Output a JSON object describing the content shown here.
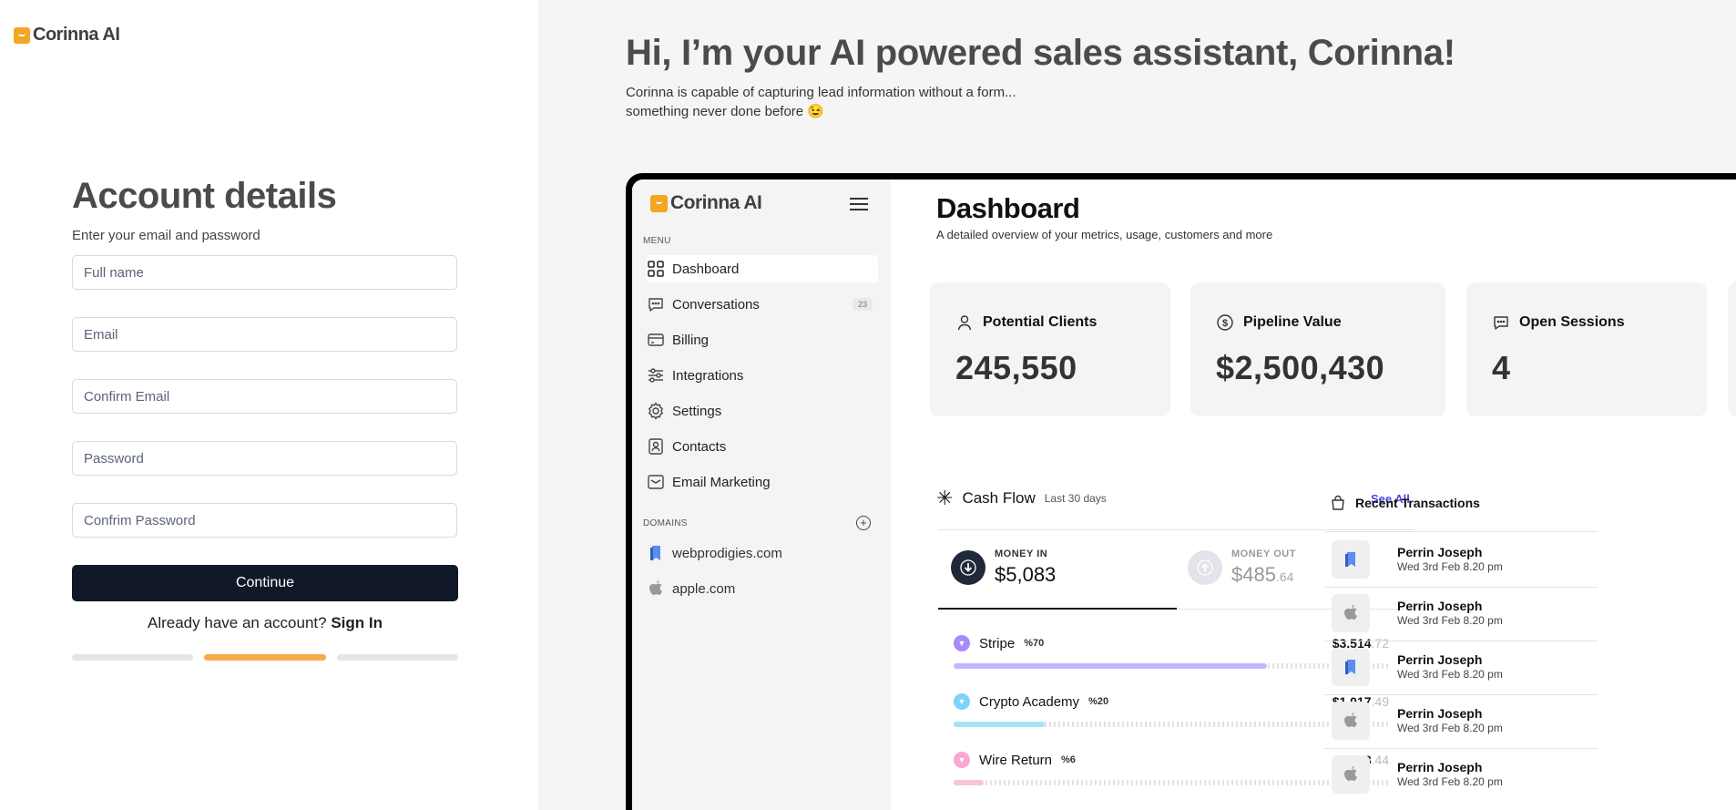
{
  "brand": {
    "name": "Corinna AI"
  },
  "signup": {
    "title": "Account details",
    "subtitle": "Enter your email and password",
    "fields": {
      "full_name": "Full name",
      "email": "Email",
      "confirm_email": "Confirm Email",
      "password": "Password",
      "confirm_password": "Confrim Password"
    },
    "continue_label": "Continue",
    "already_text": "Already have an account?",
    "sign_in_label": "Sign In",
    "steps_total": 3,
    "step_active": 2,
    "colors": {
      "active_step": "#f9a94a",
      "inactive_step": "#e6e6e6",
      "button": "#111827"
    }
  },
  "hero": {
    "title": "Hi, I’m your AI powered sales assistant, Corinna!",
    "line1": "Corinna is capable of capturing lead information without a form...",
    "line2": "something never done before 😉"
  },
  "preview": {
    "sidebar": {
      "menu_label": "MENU",
      "items": [
        {
          "label": "Dashboard",
          "icon": "grid-icon",
          "active": true
        },
        {
          "label": "Conversations",
          "icon": "chat-icon",
          "badge": "23"
        },
        {
          "label": "Billing",
          "icon": "credit-card-icon"
        },
        {
          "label": "Integrations",
          "icon": "sliders-icon"
        },
        {
          "label": "Settings",
          "icon": "gear-icon"
        },
        {
          "label": "Contacts",
          "icon": "contact-icon"
        },
        {
          "label": "Email Marketing",
          "icon": "mail-icon"
        }
      ],
      "domains_label": "DOMAINS",
      "domains": [
        {
          "label": "webprodigies.com",
          "icon": "bookmark-icon"
        },
        {
          "label": "apple.com",
          "icon": "apple-icon"
        }
      ]
    },
    "dashboard": {
      "title": "Dashboard",
      "subtitle": "A detailed overview of your metrics, usage, customers and more",
      "cards": [
        {
          "label": "Potential Clients",
          "value": "245,550",
          "icon": "user-icon"
        },
        {
          "label": "Pipeline Value",
          "value": "$2,500,430",
          "icon": "dollar-icon"
        },
        {
          "label": "Open Sessions",
          "value": "4",
          "icon": "chat-icon"
        }
      ],
      "cash_flow": {
        "title": "Cash Flow",
        "period": "Last 30 days",
        "see_all": "See All",
        "money_in": {
          "label": "MONEY IN",
          "value": "$5,083"
        },
        "money_out": {
          "label": "MONEY OUT",
          "value": "$485",
          "decimal": ".64"
        },
        "transactions": [
          {
            "name": "Stripe",
            "pct": "%70",
            "amount": "$3,514",
            "decimal": ".72",
            "fill": 0.72,
            "color": "#c4b5fd",
            "dot": "#a78bfa"
          },
          {
            "name": "Crypto Academy",
            "pct": "%20",
            "amount": "$1,017",
            "decimal": ".49",
            "fill": 0.21,
            "color": "#a5e4f3",
            "dot": "#7dd3fc"
          },
          {
            "name": "Wire Return",
            "pct": "%6",
            "amount": "$318",
            "decimal": ".44",
            "fill": 0.07,
            "color": "#f9c4d8",
            "dot": "#f9a8d4"
          }
        ]
      },
      "recent": {
        "title": "Recent Transactions",
        "rows": [
          {
            "name": "Perrin Joseph",
            "date": "Wed 3rd Feb 8.20 pm",
            "icon": "bookmark-icon"
          },
          {
            "name": "Perrin Joseph",
            "date": "Wed 3rd Feb 8.20 pm",
            "icon": "apple-icon"
          },
          {
            "name": "Perrin Joseph",
            "date": "Wed 3rd Feb 8.20 pm",
            "icon": "bookmark-icon"
          },
          {
            "name": "Perrin Joseph",
            "date": "Wed 3rd Feb 8.20 pm",
            "icon": "apple-icon"
          },
          {
            "name": "Perrin Joseph",
            "date": "Wed 3rd Feb 8.20 pm",
            "icon": "apple-icon"
          }
        ]
      }
    }
  }
}
